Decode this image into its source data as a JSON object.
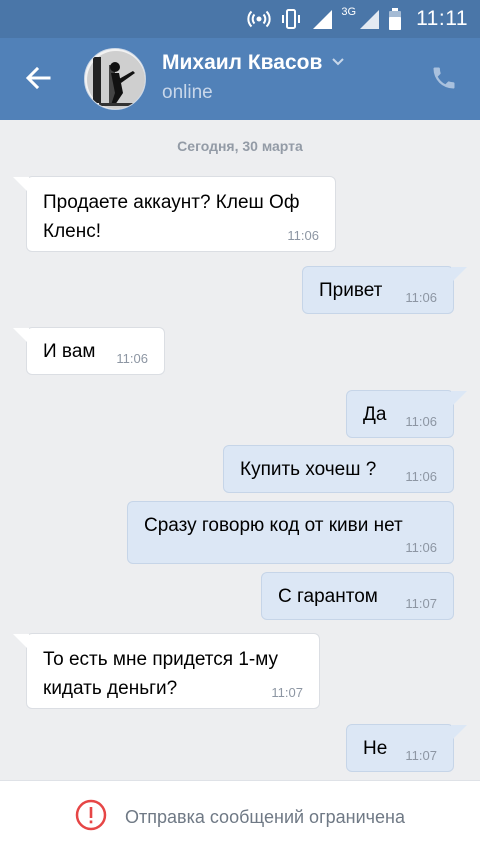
{
  "status_bar": {
    "network": "3G",
    "time": "11:11",
    "icons": [
      "hotspot-icon",
      "vibrate-icon",
      "signal-icon",
      "signal-icon",
      "battery-icon"
    ]
  },
  "header": {
    "contact_name": "Михаил Квасов",
    "presence": "online",
    "icons": [
      "back-arrow-icon",
      "chevron-down-icon",
      "phone-icon"
    ]
  },
  "conversation": {
    "date_separator": "Сегодня, 30 марта",
    "messages": [
      {
        "dir": "in",
        "text": "Продаете аккаунт? Клеш Оф Кленс!",
        "time": "11:06"
      },
      {
        "dir": "out",
        "text": "Привет",
        "time": "11:06"
      },
      {
        "dir": "in",
        "text": "И вам",
        "time": "11:06"
      },
      {
        "dir": "out",
        "text": "Да",
        "time": "11:06"
      },
      {
        "dir": "out",
        "text": "Купить хочеш ?",
        "time": "11:06"
      },
      {
        "dir": "out",
        "text": "Сразу говорю код от киви нет",
        "time": "11:06"
      },
      {
        "dir": "out",
        "text": "С гарантом",
        "time": "11:07"
      },
      {
        "dir": "in",
        "text": "То есть мне придется 1-му кидать деньги?",
        "time": "11:07"
      },
      {
        "dir": "out",
        "text": "Не",
        "time": "11:07"
      }
    ]
  },
  "footer": {
    "notice": "Отправка сообщений ограничена",
    "icon": "warning-icon",
    "accent_color": "#e64646"
  },
  "colors": {
    "header_bg": "#5181b8",
    "statusbar_bg": "#4a76a8",
    "chat_bg": "#edeef0",
    "incoming_bubble": "#ffffff",
    "outgoing_bubble": "#dce7f5"
  }
}
